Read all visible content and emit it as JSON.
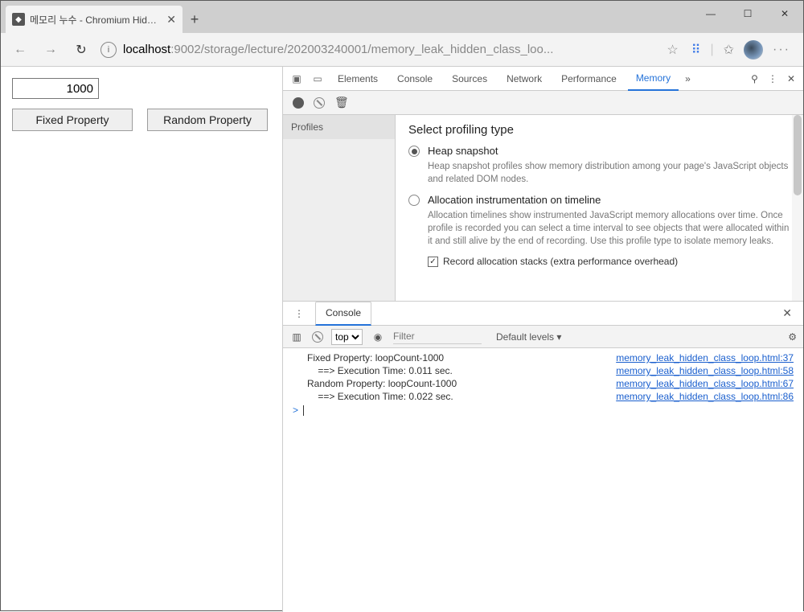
{
  "window": {
    "tab_title": "메모리 누수 - Chromium Hidden",
    "minimize": "—",
    "maximize": "☐",
    "close": "✕"
  },
  "address": {
    "url_prefix": "localhost",
    "url_rest": ":9002/storage/lecture/202003240001/memory_leak_hidden_class_loo...",
    "star": "☆",
    "translate": "✶",
    "favstar": "✩"
  },
  "page": {
    "input_value": "1000",
    "btn_fixed": "Fixed Property",
    "btn_random": "Random Property"
  },
  "devtools": {
    "tabs": {
      "elements": "Elements",
      "console": "Console",
      "sources": "Sources",
      "network": "Network",
      "performance": "Performance",
      "memory": "Memory"
    },
    "more": "»",
    "settings_dots": "⋮",
    "close": "✕"
  },
  "memory": {
    "profiles_header": "Profiles",
    "heading": "Select profiling type",
    "heap_label": "Heap snapshot",
    "heap_desc": "Heap snapshot profiles show memory distribution among your page's JavaScript objects and related DOM nodes.",
    "alloc_label": "Allocation instrumentation on timeline",
    "alloc_desc": "Allocation timelines show instrumented JavaScript memory allocations over time. Once profile is recorded you can select a time interval to see objects that were allocated within it and still alive by the end of recording. Use this profile type to isolate memory leaks.",
    "record_stacks": "Record allocation stacks (extra performance overhead)"
  },
  "drawer": {
    "tab": "Console",
    "context": "top",
    "filter_placeholder": "Filter",
    "levels": "Default levels ▾"
  },
  "console_lines": [
    {
      "msg": "Fixed Property: loopCount-1000",
      "src": "memory_leak_hidden_class_loop.html:37"
    },
    {
      "msg": "    ==> Execution Time: 0.011 sec.",
      "src": "memory_leak_hidden_class_loop.html:58"
    },
    {
      "msg": "Random Property: loopCount-1000",
      "src": "memory_leak_hidden_class_loop.html:67"
    },
    {
      "msg": "    ==> Execution Time: 0.022 sec.",
      "src": "memory_leak_hidden_class_loop.html:86"
    }
  ]
}
